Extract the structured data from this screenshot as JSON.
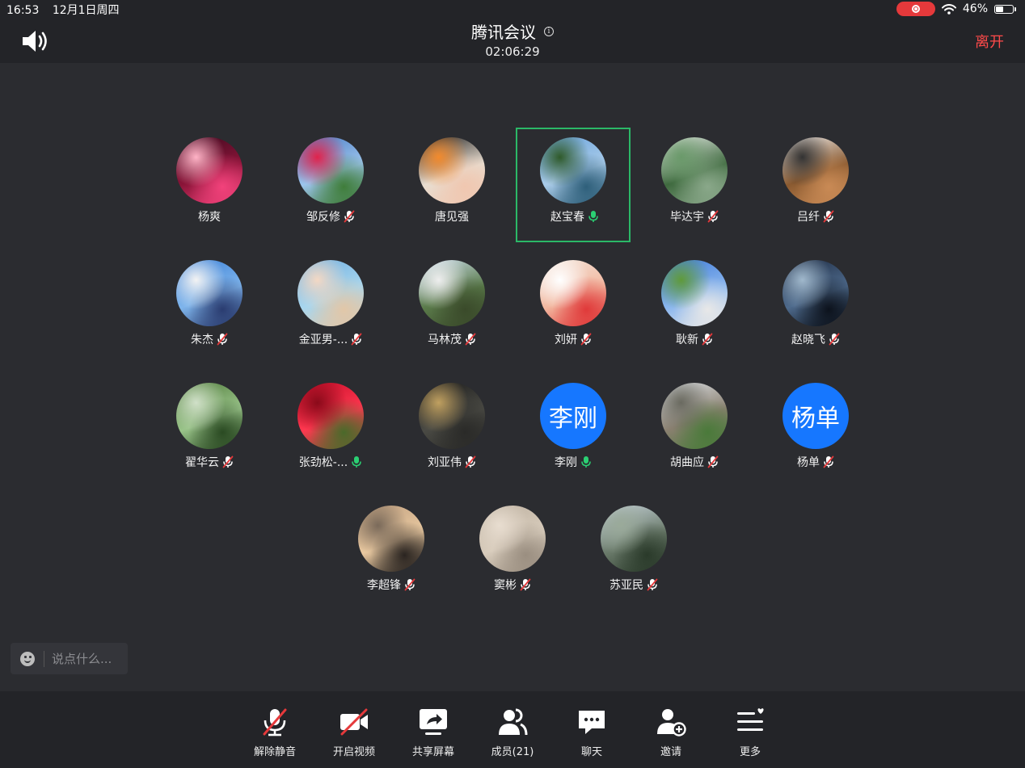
{
  "status_bar": {
    "time": "16:53",
    "date": "12月1日周四",
    "battery": "46%",
    "battery_level": 0.46
  },
  "header": {
    "title": "腾讯会议",
    "timer": "02:06:29",
    "leave": "离开"
  },
  "members": [
    {
      "name": "杨爽",
      "mic": "none",
      "palette": [
        "#3a0a1e",
        "#8a1438",
        "#f2427b",
        "#ffb3c6"
      ]
    },
    {
      "name": "邹反修",
      "mic": "muted",
      "palette": [
        "#4a7bc4",
        "#9cc4ec",
        "#3f7d3a",
        "#e0234c"
      ]
    },
    {
      "name": "唐见强",
      "mic": "none",
      "palette": [
        "#1a1a1a",
        "#e8ddd0",
        "#f0c7b0",
        "#f28a2d"
      ]
    },
    {
      "name": "赵宝春",
      "mic": "on",
      "active": true,
      "palette": [
        "#6aa3dc",
        "#a9cbe9",
        "#2e5f7a",
        "#2f5a2a"
      ]
    },
    {
      "name": "毕达宇",
      "mic": "muted",
      "palette": [
        "#e8ece8",
        "#3f6a3f",
        "#8aa88a",
        "#6a9a6a"
      ]
    },
    {
      "name": "吕纤",
      "mic": "muted",
      "palette": [
        "#f0f0f0",
        "#8a5a30",
        "#c98a55",
        "#333333"
      ]
    },
    {
      "name": "朱杰",
      "mic": "muted",
      "palette": [
        "#3a7fd6",
        "#7fb5ec",
        "#2a3c70",
        "#f3f3f3"
      ]
    },
    {
      "name": "金亚男-...",
      "mic": "muted",
      "palette": [
        "#6faee0",
        "#a8d6ee",
        "#e2c7a8",
        "#f3d8c4"
      ]
    },
    {
      "name": "马林茂",
      "mic": "muted",
      "palette": [
        "#cfe0f0",
        "#5a7a4a",
        "#3a4a2a",
        "#eeeeee"
      ]
    },
    {
      "name": "刘妍",
      "mic": "muted",
      "palette": [
        "#f3e7dd",
        "#f2b8a0",
        "#e03a3a",
        "#ffffff"
      ]
    },
    {
      "name": "耿新",
      "mic": "muted",
      "palette": [
        "#3c78d8",
        "#8ab6ee",
        "#e8e8e8",
        "#5f9a3a"
      ]
    },
    {
      "name": "赵晓飞",
      "mic": "muted",
      "palette": [
        "#1d2a40",
        "#4e6a8c",
        "#0c121c",
        "#a0b8cc"
      ]
    },
    {
      "name": "翟华云",
      "mic": "muted",
      "palette": [
        "#4f7a3a",
        "#9ac48a",
        "#2a4a22",
        "#d0e0c8"
      ]
    },
    {
      "name": "张劲松-...",
      "mic": "on",
      "palette": [
        "#c80d2a",
        "#ff3850",
        "#4a6a2a",
        "#8a0a1a"
      ]
    },
    {
      "name": "刘亚伟",
      "mic": "muted",
      "palette": [
        "#1a1a1a",
        "#4a4a44",
        "#2a2a28",
        "#c0a060"
      ]
    },
    {
      "name": "李刚",
      "mic": "on",
      "text": "李刚",
      "palette": [
        "#1677ff"
      ]
    },
    {
      "name": "胡曲应",
      "mic": "muted",
      "palette": [
        "#dfe4ea",
        "#8a8070",
        "#4a7a3a",
        "#6a6a60"
      ]
    },
    {
      "name": "杨单",
      "mic": "muted",
      "text": "杨单",
      "palette": [
        "#1677ff"
      ]
    },
    {
      "name": "李超锋",
      "mic": "muted",
      "palette": [
        "#c0a080",
        "#e8c8a0",
        "#2a2420",
        "#7a6a5a"
      ]
    },
    {
      "name": "窦彬",
      "mic": "muted",
      "palette": [
        "#bcb0a0",
        "#d8ccbc",
        "#9a8e80",
        "#e8ddd0"
      ]
    },
    {
      "name": "苏亚民",
      "mic": "muted",
      "palette": [
        "#c8d4dc",
        "#6a7a6a",
        "#2a3a2a",
        "#9aaa9a"
      ]
    }
  ],
  "chat": {
    "placeholder": "说点什么..."
  },
  "toolbar": [
    {
      "id": "unmute",
      "label": "解除静音",
      "icon": "mic-off-icon"
    },
    {
      "id": "video",
      "label": "开启视频",
      "icon": "camera-off-icon"
    },
    {
      "id": "share",
      "label": "共享屏幕",
      "icon": "share-screen-icon"
    },
    {
      "id": "members",
      "label": "成员(21)",
      "icon": "members-icon"
    },
    {
      "id": "chat",
      "label": "聊天",
      "icon": "chat-icon"
    },
    {
      "id": "invite",
      "label": "邀请",
      "icon": "invite-icon"
    },
    {
      "id": "more",
      "label": "更多",
      "icon": "more-icon"
    }
  ],
  "colors": {
    "active_border": "#2bb867",
    "mic_on": "#2bd073",
    "muted_slash": "#e5393b",
    "leave": "#ff4a4a",
    "avatar_text_bg": "#1677ff"
  }
}
